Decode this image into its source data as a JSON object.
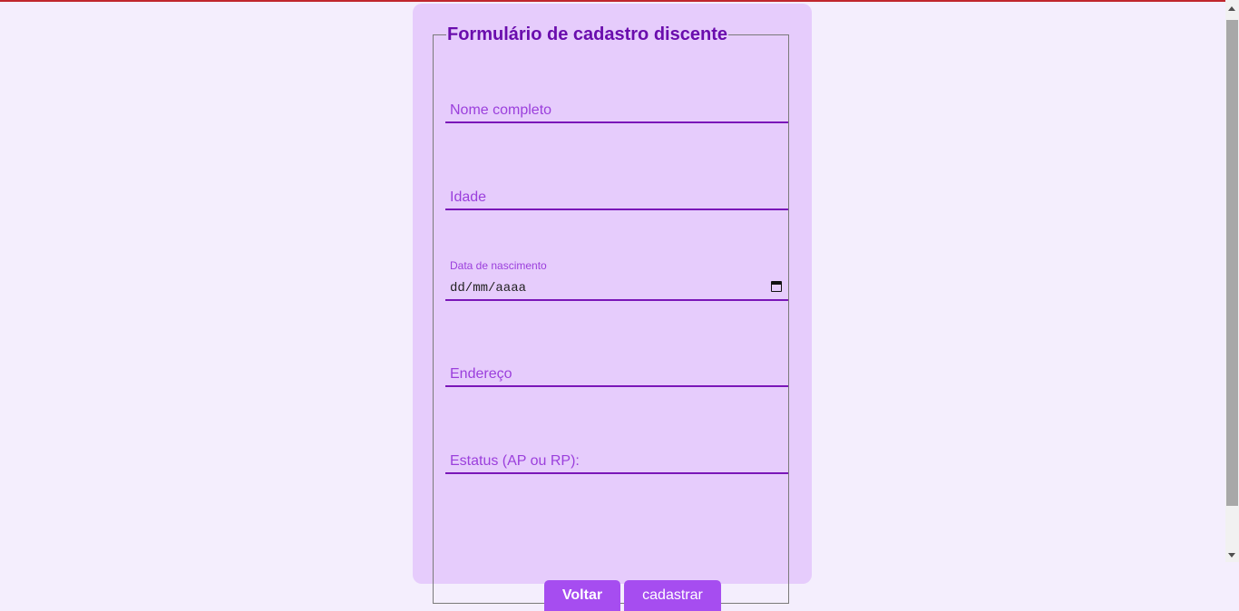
{
  "form": {
    "title": "Formulário de cadastro discente",
    "fields": {
      "nome": {
        "placeholder": "Nome completo"
      },
      "idade": {
        "placeholder": "Idade"
      },
      "data": {
        "label": "Data de nascimento",
        "value": "dd/mm/aaaa"
      },
      "endereco": {
        "placeholder": "Endereço"
      },
      "estatus": {
        "placeholder": "Estatus (AP ou RP):"
      }
    },
    "buttons": {
      "back_label": "Voltar",
      "submit_label": "cadastrar"
    }
  },
  "colors": {
    "background": "#f4eefd",
    "card": "#e6ccfc",
    "accent": "#a64df0",
    "title": "#6a0dad",
    "field_underline": "#7a16b8",
    "placeholder": "#9b3fdc",
    "top_line": "#c0262d"
  },
  "icons": {
    "date_picker": "calendar-icon"
  }
}
